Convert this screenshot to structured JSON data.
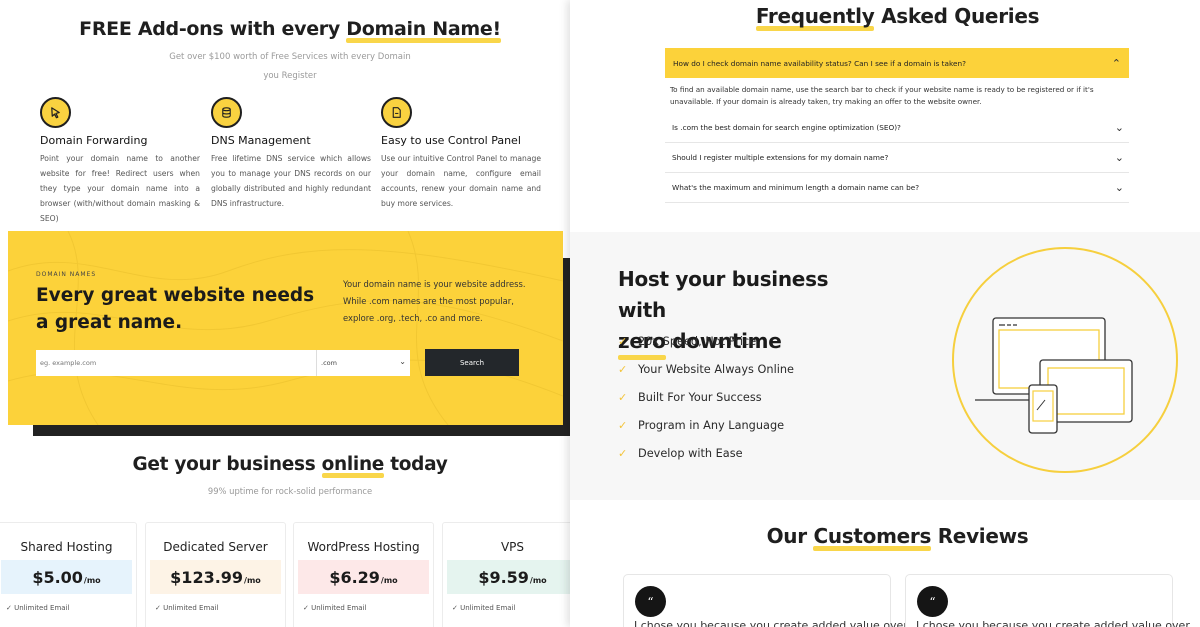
{
  "addons": {
    "title_pre": "FREE Add-ons with every ",
    "title_hl": "Domain Name!",
    "subtitle": "Get over $100 worth of Free Services with every Domain you Register",
    "features": [
      {
        "icon": "cursor-icon",
        "title": "Domain Forwarding",
        "text": "Point your domain name to another website for free! Redirect users when they type your domain name into a browser (with/without domain masking & SEO)"
      },
      {
        "icon": "database-icon",
        "title": "DNS Management",
        "text": "Free lifetime DNS service which allows you to manage your DNS records on our globally distributed and highly redundant DNS infrastructure."
      },
      {
        "icon": "document-icon",
        "title": "Easy to use Control Panel",
        "text": "Use our intuitive Control Panel to manage your domain name, configure email accounts, renew your domain name and buy more services."
      }
    ]
  },
  "domain_search": {
    "eyebrow": "DOMAIN NAMES",
    "headline": "Every great website needs a great name.",
    "description": "Your domain name is your website address. While .com names are the most popular, explore .org, .tech, .co and more.",
    "placeholder": "eg. example.com",
    "tld_selected": ".com",
    "button": "Search"
  },
  "pricing": {
    "title_pre": "Get your business ",
    "title_hl": "online",
    "title_post": " today",
    "subtitle": "99% uptime for rock-solid performance",
    "plans": [
      {
        "name": "Shared Hosting",
        "price": "$5.00",
        "unit": "/mo",
        "feature": "Unlimited Email",
        "bg": "#e6f3fc"
      },
      {
        "name": "Dedicated Server",
        "price": "$123.99",
        "unit": "/mo",
        "feature": "Unlimited Email",
        "bg": "#fdf3e6"
      },
      {
        "name": "WordPress Hosting",
        "price": "$6.29",
        "unit": "/mo",
        "feature": "Unlimited Email",
        "bg": "#fde8e8"
      },
      {
        "name": "VPS",
        "price": "$9.59",
        "unit": "/mo",
        "feature": "Unlimited Email",
        "bg": "#e5f4ef"
      }
    ]
  },
  "faq": {
    "title_hl": "Frequently",
    "title_post": " Asked Queries",
    "open_question": "How do I check domain name availability status? Can I see if a domain is taken?",
    "open_answer": "To find an available domain name, use the search bar to check if your website name is ready to be registered or if it's unavailable. If your domain is already taken, try making an offer to the website owner.",
    "questions": [
      "Is .com the best domain for search engine optimization (SEO)?",
      "Should I register multiple extensions for my domain name?",
      "What's the maximum and minimum length a domain name can be?"
    ]
  },
  "host": {
    "title_line1": "Host your business with",
    "title_hl": "zero",
    "title_post": " downtime",
    "items": [
      "20x Speed, Not Price",
      "Your Website Always Online",
      "Built For Your Success",
      "Program in Any Language",
      "Develop with Ease"
    ]
  },
  "reviews": {
    "title_pre": "Our ",
    "title_hl": "Customers",
    "title_post": " Reviews",
    "cards": [
      {
        "text": "I chose you because you create added value over"
      },
      {
        "text": "I chose you because you create added value over"
      }
    ]
  },
  "colors": {
    "accent": "#fcd23a",
    "dark": "#23272b"
  }
}
